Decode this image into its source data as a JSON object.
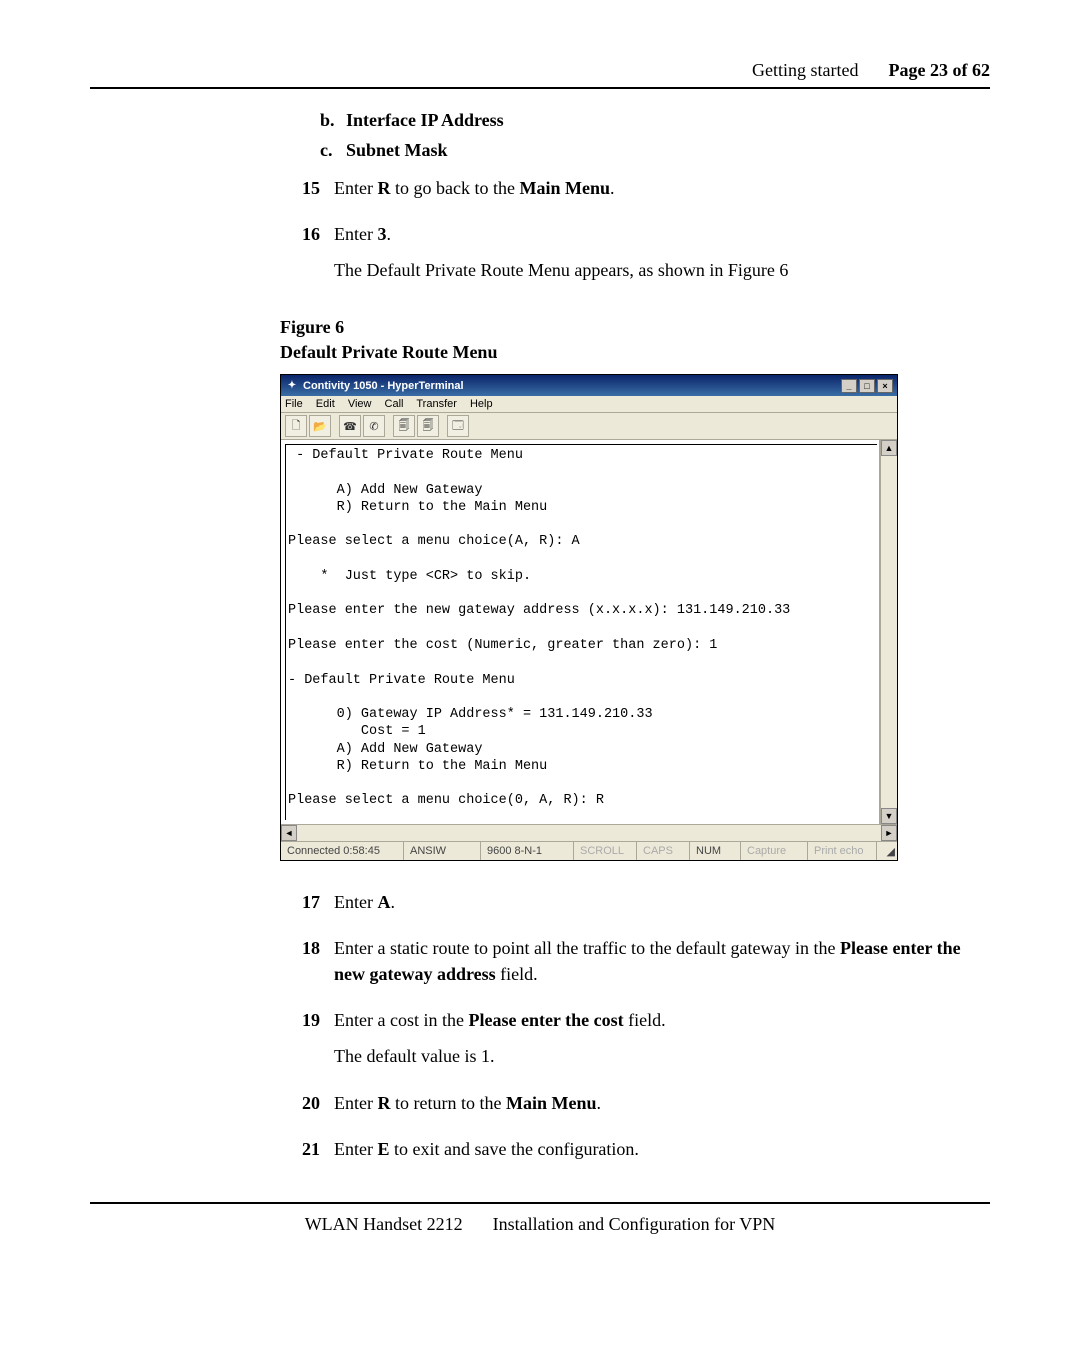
{
  "header": {
    "section": "Getting started",
    "page_label": "Page 23 of 62"
  },
  "sub_items": {
    "b": {
      "marker": "b.",
      "text": "Interface IP Address"
    },
    "c": {
      "marker": "c.",
      "text": "Subnet Mask"
    }
  },
  "steps": {
    "s15": {
      "num": "15",
      "t1a": "Enter ",
      "t1b": "R",
      "t1c": " to go back to the ",
      "t1d": "Main Menu",
      "t1e": "."
    },
    "s16": {
      "num": "16",
      "t1a": "Enter ",
      "t1b": "3",
      "t1c": ".",
      "t2": "The Default Private Route Menu appears, as shown in Figure 6"
    },
    "s17": {
      "num": "17",
      "t1a": "Enter ",
      "t1b": "A",
      "t1c": "."
    },
    "s18": {
      "num": "18",
      "t1a": "Enter a static route to point all the traffic to the default gateway in the ",
      "t1b": "Please enter the new gateway address",
      "t1c": " field."
    },
    "s19": {
      "num": "19",
      "t1a": "Enter a cost in the ",
      "t1b": "Please enter the cost",
      "t1c": " field.",
      "t2": "The default value is 1."
    },
    "s20": {
      "num": "20",
      "t1a": "Enter ",
      "t1b": "R",
      "t1c": " to return to the ",
      "t1d": "Main Menu",
      "t1e": "."
    },
    "s21": {
      "num": "21",
      "t1a": "Enter ",
      "t1b": "E",
      "t1c": " to exit and save the configuration."
    }
  },
  "figure": {
    "label": "Figure 6",
    "title": "Default Private Route Menu"
  },
  "ht": {
    "title": "Contivity 1050 - HyperTerminal",
    "menu": {
      "file": "File",
      "edit": "Edit",
      "view": "View",
      "call": "Call",
      "transfer": "Transfer",
      "help": "Help"
    },
    "winbtns": {
      "min": "_",
      "max": "□",
      "close": "×"
    },
    "terminal_text": " - Default Private Route Menu\n\n      A) Add New Gateway\n      R) Return to the Main Menu\n\nPlease select a menu choice(A, R): A\n\n    *  Just type <CR> to skip.\n\nPlease enter the new gateway address (x.x.x.x): 131.149.210.33\n\nPlease enter the cost (Numeric, greater than zero): 1\n\n- Default Private Route Menu\n\n      0) Gateway IP Address* = 131.149.210.33\n         Cost = 1\n      A) Add New Gateway\n      R) Return to the Main Menu\n\nPlease select a menu choice(0, A, R): R",
    "status": {
      "connected": "Connected 0:58:45",
      "emu": "ANSIW",
      "line": "9600 8-N-1",
      "scroll": "SCROLL",
      "caps": "CAPS",
      "num": "NUM",
      "capture": "Capture",
      "printecho": "Print echo"
    }
  },
  "footer": {
    "left": "WLAN Handset 2212",
    "right": "Installation and Configuration for VPN"
  }
}
